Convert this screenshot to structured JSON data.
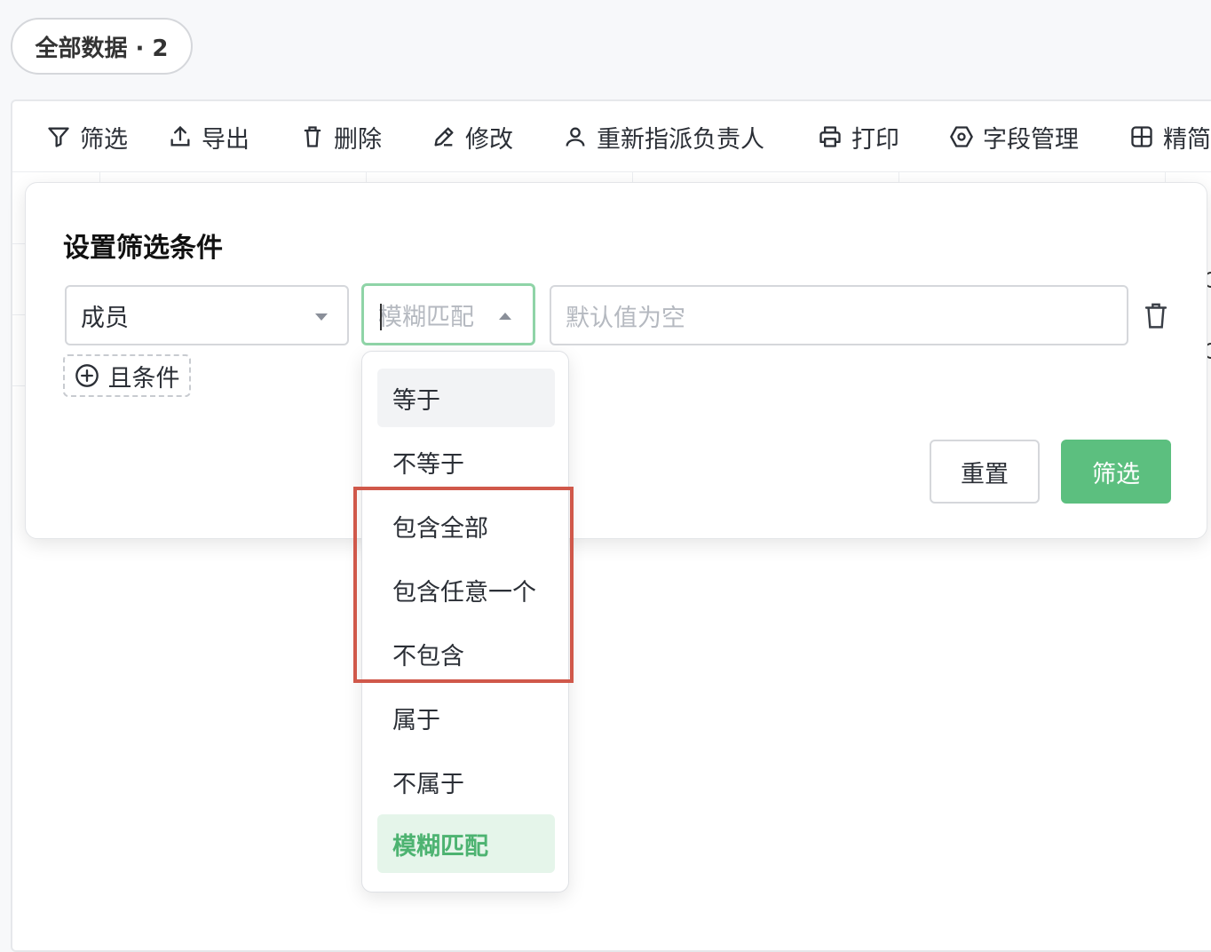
{
  "view_pill": {
    "label": "全部数据 · 2"
  },
  "toolbar": {
    "items": [
      {
        "label": "筛选",
        "icon": "filter-icon"
      },
      {
        "label": "导出",
        "icon": "upload-icon"
      },
      {
        "label": "删除",
        "icon": "trash-icon"
      },
      {
        "label": "修改",
        "icon": "pencil-icon"
      },
      {
        "label": "重新指派负责人",
        "icon": "user-icon"
      },
      {
        "label": "打印",
        "icon": "printer-icon"
      },
      {
        "label": "字段管理",
        "icon": "gear-icon"
      },
      {
        "label": "精简",
        "icon": "grid-icon"
      }
    ]
  },
  "filter_modal": {
    "title": "设置筛选条件",
    "field_select": {
      "value": "成员"
    },
    "operator_select": {
      "placeholder": "模糊匹配"
    },
    "value_input": {
      "placeholder": "默认值为空"
    },
    "add_condition_label": "且条件",
    "reset_label": "重置",
    "filter_label": "筛选"
  },
  "operator_dropdown": {
    "options": [
      "等于",
      "不等于",
      "包含全部",
      "包含任意一个",
      "不包含",
      "属于",
      "不属于",
      "模糊匹配"
    ],
    "hovered": "等于",
    "selected": "模糊匹配"
  },
  "colors": {
    "accent_green": "#5cbf7f",
    "selected_text": "#4db371",
    "highlight_red": "#d0584a"
  }
}
